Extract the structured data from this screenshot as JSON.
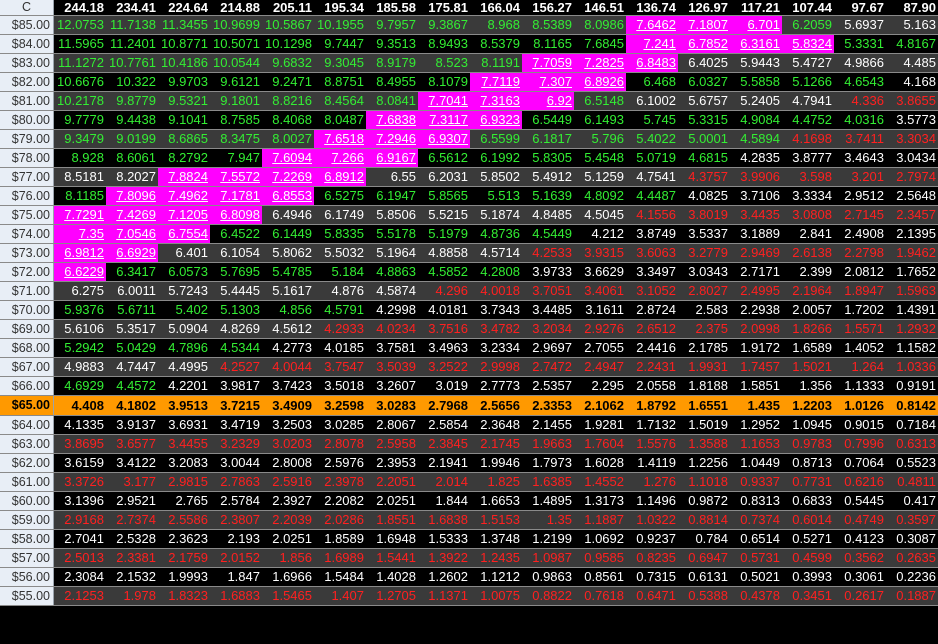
{
  "corner": "C",
  "columns": [
    "244.18",
    "234.41",
    "224.64",
    "214.88",
    "205.11",
    "195.34",
    "185.58",
    "175.81",
    "166.04",
    "156.27",
    "146.51",
    "136.74",
    "126.97",
    "117.21",
    "107.44",
    "97.67",
    "87.90"
  ],
  "rows": [
    {
      "label": "$85.00",
      "values": [
        "12.0753",
        "11.7138",
        "11.3455",
        "10.9699",
        "10.5867",
        "10.1955",
        "9.7957",
        "9.3867",
        "8.968",
        "8.5389",
        "8.0986",
        "7.6462",
        "7.1807",
        "6.701",
        "6.2059",
        "5.6937",
        "5.163"
      ],
      "colors": "gggggggggggmmmgww"
    },
    {
      "label": "$84.00",
      "values": [
        "11.5965",
        "11.2401",
        "10.8771",
        "10.5071",
        "10.1298",
        "9.7447",
        "9.3513",
        "8.9493",
        "8.5379",
        "8.1165",
        "7.6845",
        "7.241",
        "6.7852",
        "6.3161",
        "5.8324",
        "5.3331",
        "4.8167"
      ],
      "colors": "gggggggggggmmmmgg"
    },
    {
      "label": "$83.00",
      "values": [
        "11.1272",
        "10.7761",
        "10.4186",
        "10.0544",
        "9.6832",
        "9.3045",
        "8.9179",
        "8.523",
        "8.1191",
        "7.7059",
        "7.2825",
        "6.8483",
        "6.4025",
        "5.9443",
        "5.4727",
        "4.9866",
        "4.485"
      ],
      "colors": "gggggggggmmmwwwww"
    },
    {
      "label": "$82.00",
      "values": [
        "10.6676",
        "10.322",
        "9.9703",
        "9.6121",
        "9.2471",
        "8.8751",
        "8.4955",
        "8.1079",
        "7.7119",
        "7.307",
        "6.8926",
        "6.468",
        "6.0327",
        "5.5858",
        "5.1266",
        "4.6543",
        "4.168"
      ],
      "colors": "ggggggggmmmgggggw"
    },
    {
      "label": "$81.00",
      "values": [
        "10.2178",
        "9.8779",
        "9.5321",
        "9.1801",
        "8.8216",
        "8.4564",
        "8.0841",
        "7.7041",
        "7.3163",
        "6.92",
        "6.5148",
        "6.1002",
        "5.6757",
        "5.2405",
        "4.7941",
        "4.336",
        "3.8655"
      ],
      "colors": "gggggggmmmgwwwwrr"
    },
    {
      "label": "$80.00",
      "values": [
        "9.7779",
        "9.4438",
        "9.1041",
        "8.7585",
        "8.4068",
        "8.0487",
        "7.6838",
        "7.3117",
        "6.9323",
        "6.5449",
        "6.1493",
        "5.745",
        "5.3315",
        "4.9084",
        "4.4752",
        "4.0316",
        "3.5773"
      ],
      "colors": "ggggggmmmgggggggww"
    },
    {
      "label": "$79.00",
      "values": [
        "9.3479",
        "9.0199",
        "8.6865",
        "8.3475",
        "8.0027",
        "7.6518",
        "7.2946",
        "6.9307",
        "6.5599",
        "6.1817",
        "5.796",
        "5.4022",
        "5.0001",
        "4.5894",
        "4.1698",
        "3.7411",
        "3.3034"
      ],
      "colors": "gggggmmmggggggrrr"
    },
    {
      "label": "$78.00",
      "values": [
        "8.928",
        "8.6061",
        "8.2792",
        "7.947",
        "7.6094",
        "7.266",
        "6.9167",
        "6.5612",
        "6.1992",
        "5.8305",
        "5.4548",
        "5.0719",
        "4.6815",
        "4.2835",
        "3.8777",
        "3.4643",
        "3.0434"
      ],
      "colors": "ggggmmmggggggwwww"
    },
    {
      "label": "$77.00",
      "values": [
        "8.5181",
        "8.2027",
        "7.8824",
        "7.5572",
        "7.2269",
        "6.8912",
        "6.55",
        "6.2031",
        "5.8502",
        "5.4912",
        "5.1259",
        "4.7541",
        "4.3757",
        "3.9906",
        "3.598",
        "3.201",
        "2.7974"
      ],
      "colors": "wwmmmmwwwwwwrrrrr"
    },
    {
      "label": "$76.00",
      "values": [
        "8.1185",
        "7.8096",
        "7.4962",
        "7.1781",
        "6.8553",
        "6.5275",
        "6.1947",
        "5.8565",
        "5.513",
        "5.1639",
        "4.8092",
        "4.4487",
        "4.0825",
        "3.7106",
        "3.3334",
        "2.9512",
        "2.5648"
      ],
      "colors": "gmmmmgggggggwwwww"
    },
    {
      "label": "$75.00",
      "values": [
        "7.7291",
        "7.4269",
        "7.1205",
        "6.8098",
        "6.4946",
        "6.1749",
        "5.8506",
        "5.5215",
        "5.1874",
        "4.8485",
        "4.5045",
        "4.1556",
        "3.8019",
        "3.4435",
        "3.0808",
        "2.7145",
        "2.3457"
      ],
      "colors": "mmmmwwwwwwwrrrrrr"
    },
    {
      "label": "$74.00",
      "values": [
        "7.35",
        "7.0546",
        "6.7554",
        "6.4522",
        "6.1449",
        "5.8335",
        "5.5178",
        "5.1979",
        "4.8736",
        "4.5449",
        "4.212",
        "3.8749",
        "3.5337",
        "3.1889",
        "2.841",
        "2.4908",
        "2.1395"
      ],
      "colors": "mmmgggggggwwwwwww"
    },
    {
      "label": "$73.00",
      "values": [
        "6.9812",
        "6.6929",
        "6.401",
        "6.1054",
        "5.8062",
        "5.5032",
        "5.1964",
        "4.8858",
        "4.5714",
        "4.2533",
        "3.9315",
        "3.6063",
        "3.2779",
        "2.9469",
        "2.6138",
        "2.2798",
        "1.9462"
      ],
      "colors": "mmwwwwwwwrrrrrrrr"
    },
    {
      "label": "$72.00",
      "values": [
        "6.6229",
        "6.3417",
        "6.0573",
        "5.7695",
        "5.4785",
        "5.184",
        "4.8863",
        "4.5852",
        "4.2808",
        "3.9733",
        "3.6629",
        "3.3497",
        "3.0343",
        "2.7171",
        "2.399",
        "2.0812",
        "1.7652"
      ],
      "colors": "mggggggggwwwwwwww"
    },
    {
      "label": "$71.00",
      "values": [
        "6.275",
        "6.0011",
        "5.7243",
        "5.4445",
        "5.1617",
        "4.876",
        "4.5874",
        "4.296",
        "4.0018",
        "3.7051",
        "3.4061",
        "3.1052",
        "2.8027",
        "2.4995",
        "2.1964",
        "1.8947",
        "1.5963"
      ],
      "colors": "wwwwwwwrrrrrrrrrr"
    },
    {
      "label": "$70.00",
      "values": [
        "5.9376",
        "5.6711",
        "5.402",
        "5.1303",
        "4.856",
        "4.5791",
        "4.2998",
        "4.0181",
        "3.7343",
        "3.4485",
        "3.1611",
        "2.8724",
        "2.583",
        "2.2938",
        "2.0057",
        "1.7202",
        "1.4391"
      ],
      "colors": "ggggggwwwwwwwwwww"
    },
    {
      "label": "$69.00",
      "values": [
        "5.6106",
        "5.3517",
        "5.0904",
        "4.8269",
        "4.5612",
        "4.2933",
        "4.0234",
        "3.7516",
        "3.4782",
        "3.2034",
        "2.9276",
        "2.6512",
        "2.375",
        "2.0998",
        "1.8266",
        "1.5571",
        "1.2932"
      ],
      "colors": "wwwwwrrrrrrrrrrrr"
    },
    {
      "label": "$68.00",
      "values": [
        "5.2942",
        "5.0429",
        "4.7896",
        "4.5344",
        "4.2773",
        "4.0185",
        "3.7581",
        "3.4963",
        "3.2334",
        "2.9697",
        "2.7055",
        "2.4416",
        "2.1785",
        "1.9172",
        "1.6589",
        "1.4052",
        "1.1582"
      ],
      "colors": "ggggwwwwwwwwwwwww"
    },
    {
      "label": "$67.00",
      "values": [
        "4.9883",
        "4.7447",
        "4.4995",
        "4.2527",
        "4.0044",
        "3.7547",
        "3.5039",
        "3.2522",
        "2.9998",
        "2.7472",
        "2.4947",
        "2.2431",
        "1.9931",
        "1.7457",
        "1.5021",
        "1.264",
        "1.0336"
      ],
      "colors": "wwwrrrrrrrrrrrrrr"
    },
    {
      "label": "$66.00",
      "values": [
        "4.6929",
        "4.4572",
        "4.2201",
        "3.9817",
        "3.7423",
        "3.5018",
        "3.2607",
        "3.019",
        "2.7773",
        "2.5357",
        "2.295",
        "2.0558",
        "1.8188",
        "1.5851",
        "1.356",
        "1.1333",
        "0.9191"
      ],
      "colors": "ggwwwwwwwwwwwwwww"
    },
    {
      "label": "$65.00",
      "highlight": true,
      "values": [
        "4.408",
        "4.1802",
        "3.9513",
        "3.7215",
        "3.4909",
        "3.2598",
        "3.0283",
        "2.7968",
        "2.5656",
        "2.3353",
        "2.1062",
        "1.8792",
        "1.6551",
        "1.435",
        "1.2203",
        "1.0126",
        "0.8142"
      ],
      "colors": "kkkkkkkkkkkkkkkkk"
    },
    {
      "label": "$64.00",
      "values": [
        "4.1335",
        "3.9137",
        "3.6931",
        "3.4719",
        "3.2503",
        "3.0285",
        "2.8067",
        "2.5854",
        "2.3648",
        "2.1455",
        "1.9281",
        "1.7132",
        "1.5019",
        "1.2952",
        "1.0945",
        "0.9015",
        "0.7184"
      ],
      "colors": "wwwwwwwwwwwwwwwww"
    },
    {
      "label": "$63.00",
      "values": [
        "3.8695",
        "3.6577",
        "3.4455",
        "3.2329",
        "3.0203",
        "2.8078",
        "2.5958",
        "2.3845",
        "2.1745",
        "1.9663",
        "1.7604",
        "1.5576",
        "1.3588",
        "1.1653",
        "0.9783",
        "0.7996",
        "0.6313"
      ],
      "colors": "rrrrrrrrrrrrrrrrr"
    },
    {
      "label": "$62.00",
      "values": [
        "3.6159",
        "3.4122",
        "3.2083",
        "3.0044",
        "2.8008",
        "2.5976",
        "2.3953",
        "2.1941",
        "1.9946",
        "1.7973",
        "1.6028",
        "1.4119",
        "1.2256",
        "1.0449",
        "0.8713",
        "0.7064",
        "0.5523"
      ],
      "colors": "wwwwwwwwwwwwwwwww"
    },
    {
      "label": "$61.00",
      "values": [
        "3.3726",
        "3.177",
        "2.9815",
        "2.7863",
        "2.5916",
        "2.3978",
        "2.2051",
        "2.014",
        "1.825",
        "1.6385",
        "1.4552",
        "1.276",
        "1.1018",
        "0.9337",
        "0.7731",
        "0.6216",
        "0.4811"
      ],
      "colors": "rrrrrrrrrrrrrrrrr"
    },
    {
      "label": "$60.00",
      "values": [
        "3.1396",
        "2.9521",
        "2.765",
        "2.5784",
        "2.3927",
        "2.2082",
        "2.0251",
        "1.844",
        "1.6653",
        "1.4895",
        "1.3173",
        "1.1496",
        "0.9872",
        "0.8313",
        "0.6833",
        "0.5445",
        "0.417"
      ],
      "colors": "wwwwwwwwwwwwwwwww"
    },
    {
      "label": "$59.00",
      "values": [
        "2.9168",
        "2.7374",
        "2.5586",
        "2.3807",
        "2.2039",
        "2.0286",
        "1.8551",
        "1.6838",
        "1.5153",
        "1.35",
        "1.1887",
        "1.0322",
        "0.8814",
        "0.7374",
        "0.6014",
        "0.4749",
        "0.3597"
      ],
      "colors": "rrrrrrrrrrrrrrrrr"
    },
    {
      "label": "$58.00",
      "values": [
        "2.7041",
        "2.5328",
        "2.3623",
        "2.193",
        "2.0251",
        "1.8589",
        "1.6948",
        "1.5333",
        "1.3748",
        "1.2199",
        "1.0692",
        "0.9237",
        "0.784",
        "0.6514",
        "0.5271",
        "0.4123",
        "0.3087"
      ],
      "colors": "wwwwwwwwwwwwwwwww"
    },
    {
      "label": "$57.00",
      "values": [
        "2.5013",
        "2.3381",
        "2.1759",
        "2.0152",
        "1.856",
        "1.6989",
        "1.5441",
        "1.3922",
        "1.2435",
        "1.0987",
        "0.9585",
        "0.8235",
        "0.6947",
        "0.5731",
        "0.4599",
        "0.3562",
        "0.2635"
      ],
      "colors": "rrrrrrrrrrrrrrrrr"
    },
    {
      "label": "$56.00",
      "values": [
        "2.3084",
        "2.1532",
        "1.9993",
        "1.847",
        "1.6966",
        "1.5484",
        "1.4028",
        "1.2602",
        "1.1212",
        "0.9863",
        "0.8561",
        "0.7315",
        "0.6131",
        "0.5021",
        "0.3993",
        "0.3061",
        "0.2236"
      ],
      "colors": "wwwwwwwwwwwwwwwww"
    },
    {
      "label": "$55.00",
      "values": [
        "2.1253",
        "1.978",
        "1.8323",
        "1.6883",
        "1.5465",
        "1.407",
        "1.2705",
        "1.1371",
        "1.0075",
        "0.8822",
        "0.7618",
        "0.6471",
        "0.5388",
        "0.4378",
        "0.3451",
        "0.2617",
        "0.1887"
      ],
      "colors": "rrrrrrrrrrrrrrrrr"
    }
  ],
  "palette": {
    "green": "#33ee33",
    "white": "#ffffff",
    "red": "#ff2020",
    "magenta": "#ff00ff",
    "highlight": "#ff9900",
    "row_dark": "#000000",
    "row_grey": "#3a3a3a",
    "label_bg": "#e8eef6"
  }
}
